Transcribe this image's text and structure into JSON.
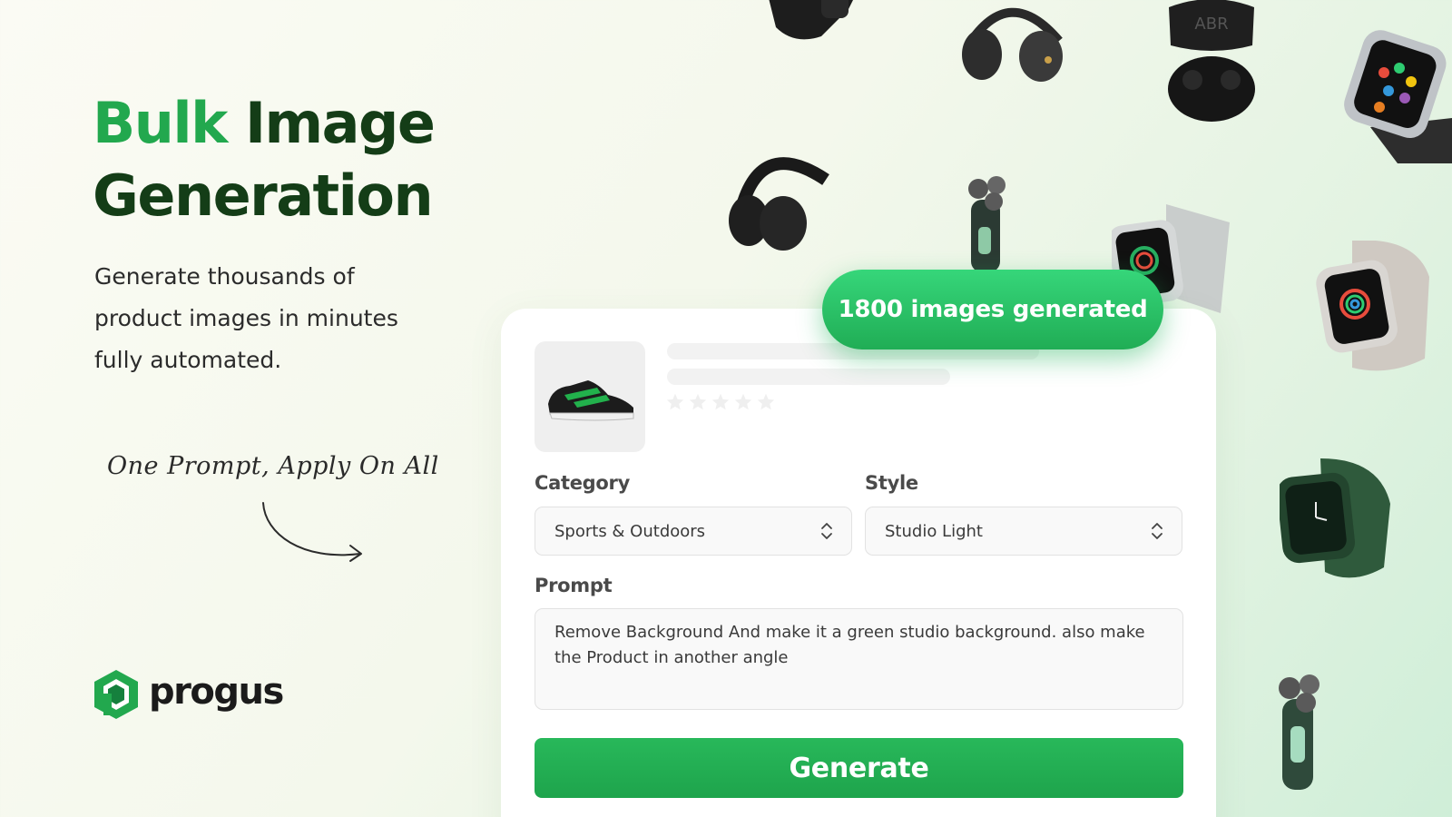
{
  "hero": {
    "title_accent": "Bulk",
    "title_rest_line1": "Image",
    "title_line2": "Generation",
    "subtitle": "Generate thousands of product images in minutes fully automated.",
    "tagline": "One Prompt, Apply On All"
  },
  "brand": {
    "name": "progus"
  },
  "badge": {
    "text": "1800 images generated"
  },
  "form": {
    "category_label": "Category",
    "category_value": "Sports & Outdoors",
    "style_label": "Style",
    "style_value": "Studio Light",
    "prompt_label": "Prompt",
    "prompt_value": "Remove Background And make it a green studio background. also make the Product in another angle",
    "generate_label": "Generate"
  },
  "colors": {
    "accent": "#22a84e",
    "title_dark": "#143d17",
    "button": "#1ea44c",
    "badge": "#2ac468"
  },
  "icons": [
    "logo-hexagon-icon",
    "arrow-curved-icon",
    "chevron-updown-icon",
    "star-icon"
  ]
}
